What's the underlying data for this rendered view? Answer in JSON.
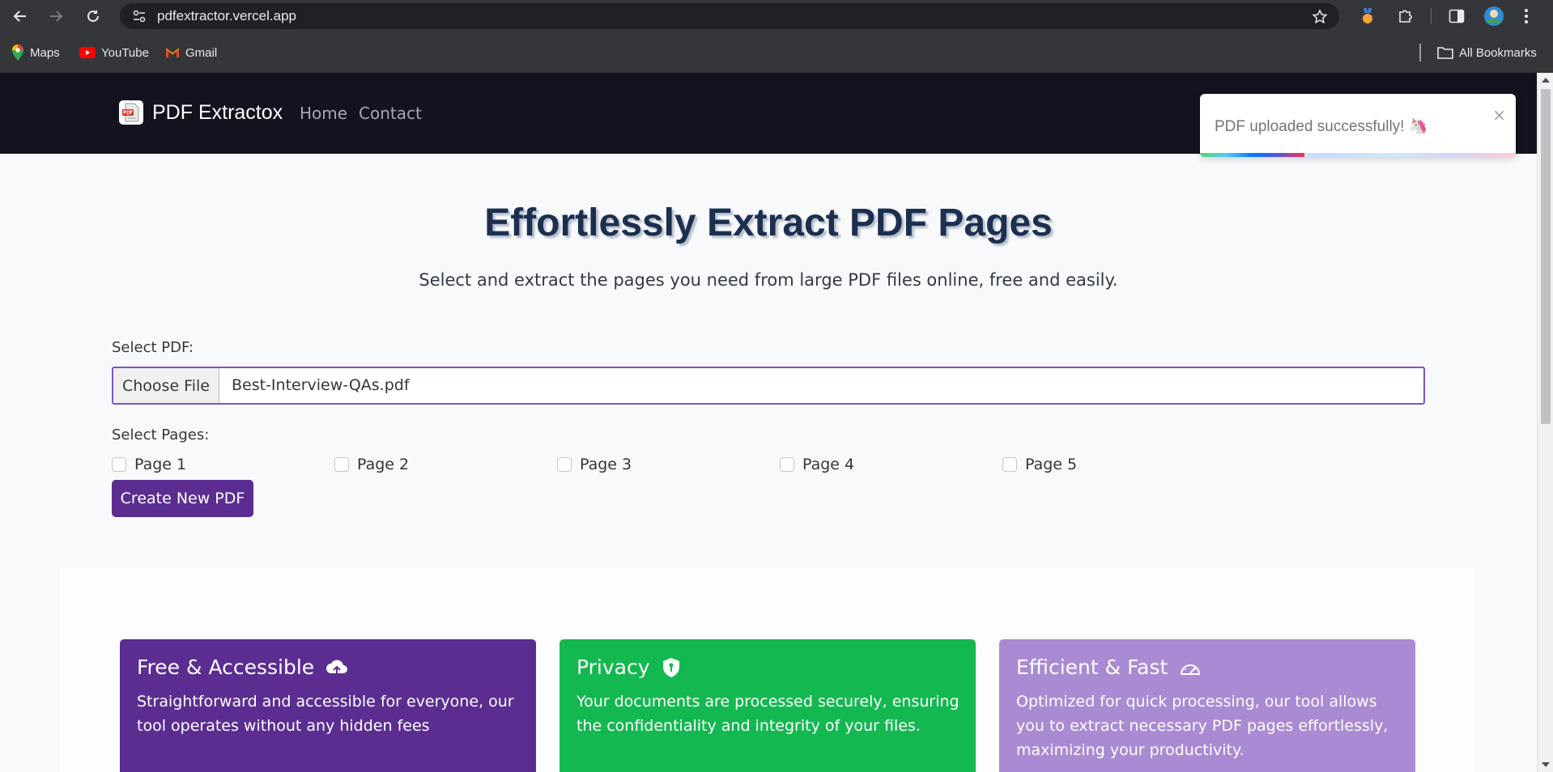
{
  "browser": {
    "url": "pdfextractor.vercel.app",
    "bookmarks": [
      {
        "label": "Maps",
        "icon": "maps-icon"
      },
      {
        "label": "YouTube",
        "icon": "youtube-icon"
      },
      {
        "label": "Gmail",
        "icon": "gmail-icon"
      }
    ],
    "all_bookmarks": "All Bookmarks"
  },
  "site": {
    "brand": "PDF Extractox",
    "nav": [
      "Home",
      "Contact"
    ]
  },
  "toast": {
    "message": "PDF uploaded successfully! 🦄",
    "close": "×",
    "progress_fraction": 0.33
  },
  "hero": {
    "title": "Effortlessly Extract PDF Pages",
    "subtitle": "Select and extract the pages you need from large PDF files online, free and easily."
  },
  "form": {
    "select_pdf_label": "Select PDF:",
    "choose_file_label": "Choose File",
    "file_name": "Best-Interview-QAs.pdf",
    "select_pages_label": "Select Pages:",
    "pages": [
      "Page 1",
      "Page 2",
      "Page 3",
      "Page 4",
      "Page 5"
    ],
    "create_button": "Create New PDF"
  },
  "features": [
    {
      "title": "Free & Accessible",
      "icon": "cloud-upload-icon",
      "text": "Straightforward and accessible for everyone, our tool operates without any hidden fees",
      "color": "#5b2d91"
    },
    {
      "title": "Privacy",
      "icon": "shield-icon",
      "text": "Your documents are processed securely, ensuring the confidentiality and integrity of your files.",
      "color": "#14b851"
    },
    {
      "title": "Efficient & Fast",
      "icon": "speedometer-icon",
      "text": "Optimized for quick processing, our tool allows you to extract necessary PDF pages effortlessly, maximizing your productivity.",
      "color": "#a98ad3"
    }
  ]
}
